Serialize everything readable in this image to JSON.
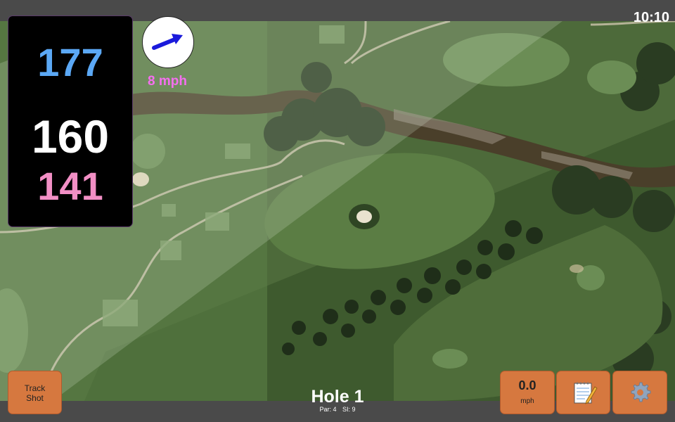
{
  "status": {
    "time": "10:10"
  },
  "distances": {
    "back": "177",
    "middle": "160",
    "front": "141"
  },
  "wind": {
    "speed": "8 mph",
    "direction_icon": "wind-arrow-icon"
  },
  "hole": {
    "title": "Hole 1",
    "par": "Par: 4",
    "stroke_index": "SI: 9"
  },
  "buttons": {
    "track_shot_line1": "Track",
    "track_shot_line2": "Shot",
    "speed_value": "0.0",
    "speed_unit": "mph",
    "notes_icon": "notepad-icon",
    "settings_icon": "gear-icon"
  },
  "colors": {
    "back_distance": "#5ba8f5",
    "middle_distance": "#ffffff",
    "front_distance": "#f28fc5",
    "wind_text": "#f56ff0",
    "button": "#d6783f"
  }
}
